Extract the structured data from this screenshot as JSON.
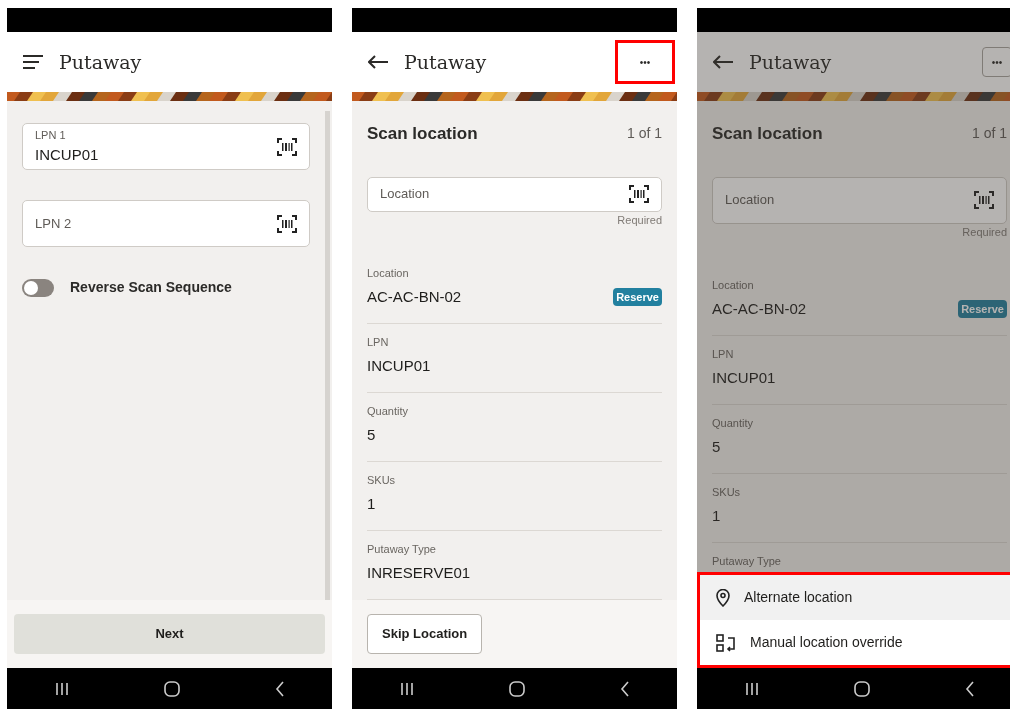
{
  "screens": [
    {
      "kind": "form",
      "title": "Putaway",
      "fields": [
        {
          "label": "LPN 1",
          "value": "INCUP01"
        },
        {
          "label": "LPN 2"
        }
      ],
      "toggle": {
        "label": "Reverse Scan Sequence",
        "on": false
      },
      "footer_button": {
        "label": "Next",
        "kind": "filled"
      }
    },
    {
      "kind": "detail",
      "title": "Putaway",
      "more_button": {
        "label": "•••",
        "highlighted": true,
        "outlined": false
      },
      "section_title": "Scan location",
      "counter": "1 of 1",
      "scan_field": {
        "placeholder": "Location",
        "helper": "Required"
      },
      "details": [
        {
          "label": "Location",
          "value": "AC-AC-BN-02",
          "tag": "Reserve"
        },
        {
          "label": "LPN",
          "value": "INCUP01"
        },
        {
          "label": "Quantity",
          "value": "5"
        },
        {
          "label": "SKUs",
          "value": "1"
        },
        {
          "label": "Putaway Type",
          "value": "INRESERVE01"
        }
      ],
      "footer_button": {
        "label": "Skip Location",
        "kind": "outlined"
      }
    },
    {
      "kind": "detail",
      "title": "Putaway",
      "dimmed": true,
      "more_button": {
        "label": "•••",
        "highlighted": false,
        "outlined": true
      },
      "section_title": "Scan location",
      "counter": "1 of 1",
      "scan_field": {
        "placeholder": "Location",
        "helper": "Required"
      },
      "details": [
        {
          "label": "Location",
          "value": "AC-AC-BN-02",
          "tag": "Reserve"
        },
        {
          "label": "LPN",
          "value": "INCUP01"
        },
        {
          "label": "Quantity",
          "value": "5"
        },
        {
          "label": "SKUs",
          "value": "1"
        },
        {
          "label": "Putaway Type"
        }
      ],
      "menu": {
        "highlighted": true,
        "items": [
          {
            "label": "Alternate location",
            "selected": true
          },
          {
            "label": "Manual location override",
            "selected": false
          }
        ]
      }
    }
  ]
}
